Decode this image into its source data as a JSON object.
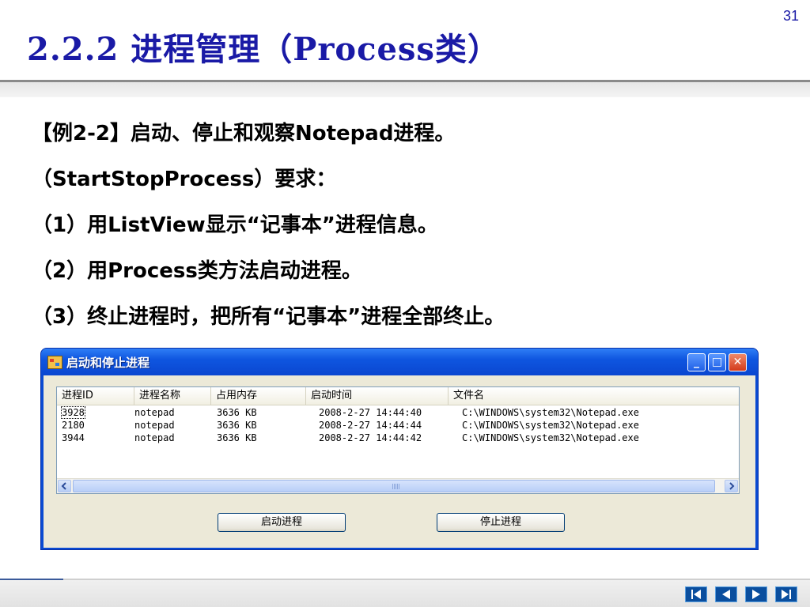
{
  "slide": {
    "title": "2.2.2  进程管理（Process类）",
    "page_number": "31",
    "lines": [
      "【例2-2】启动、停止和观察Notepad进程。",
      "（StartStopProcess）要求：",
      "（1）用ListView显示“记事本”进程信息。",
      "（2）用Process类方法启动进程。",
      "（3）终止进程时，把所有“记事本”进程全部终止。"
    ]
  },
  "window": {
    "title": "启动和停止进程",
    "minimize_glyph": "_",
    "maximize_glyph": "□",
    "close_glyph": "✕",
    "columns": [
      "进程ID",
      "进程名称",
      "占用内存",
      "启动时间",
      "文件名"
    ],
    "rows": [
      [
        "3928",
        "notepad",
        "3636 KB",
        "2008-2-27 14:44:40",
        "C:\\WINDOWS\\system32\\Notepad.exe"
      ],
      [
        "2180",
        "notepad",
        "3636 KB",
        "2008-2-27 14:44:44",
        "C:\\WINDOWS\\system32\\Notepad.exe"
      ],
      [
        "3944",
        "notepad",
        "3636 KB",
        "2008-2-27 14:44:42",
        "C:\\WINDOWS\\system32\\Notepad.exe"
      ]
    ],
    "start_button": "启动进程",
    "stop_button": "停止进程"
  },
  "icons": {
    "title_icon": "app-window-icon",
    "nav": [
      "first-slide-icon",
      "prev-slide-icon",
      "next-slide-icon",
      "last-slide-icon"
    ]
  },
  "colors": {
    "title_text": "#1a1aa6",
    "window_frame": "#0a4ad2",
    "nav_button": "#0a4e9e"
  }
}
